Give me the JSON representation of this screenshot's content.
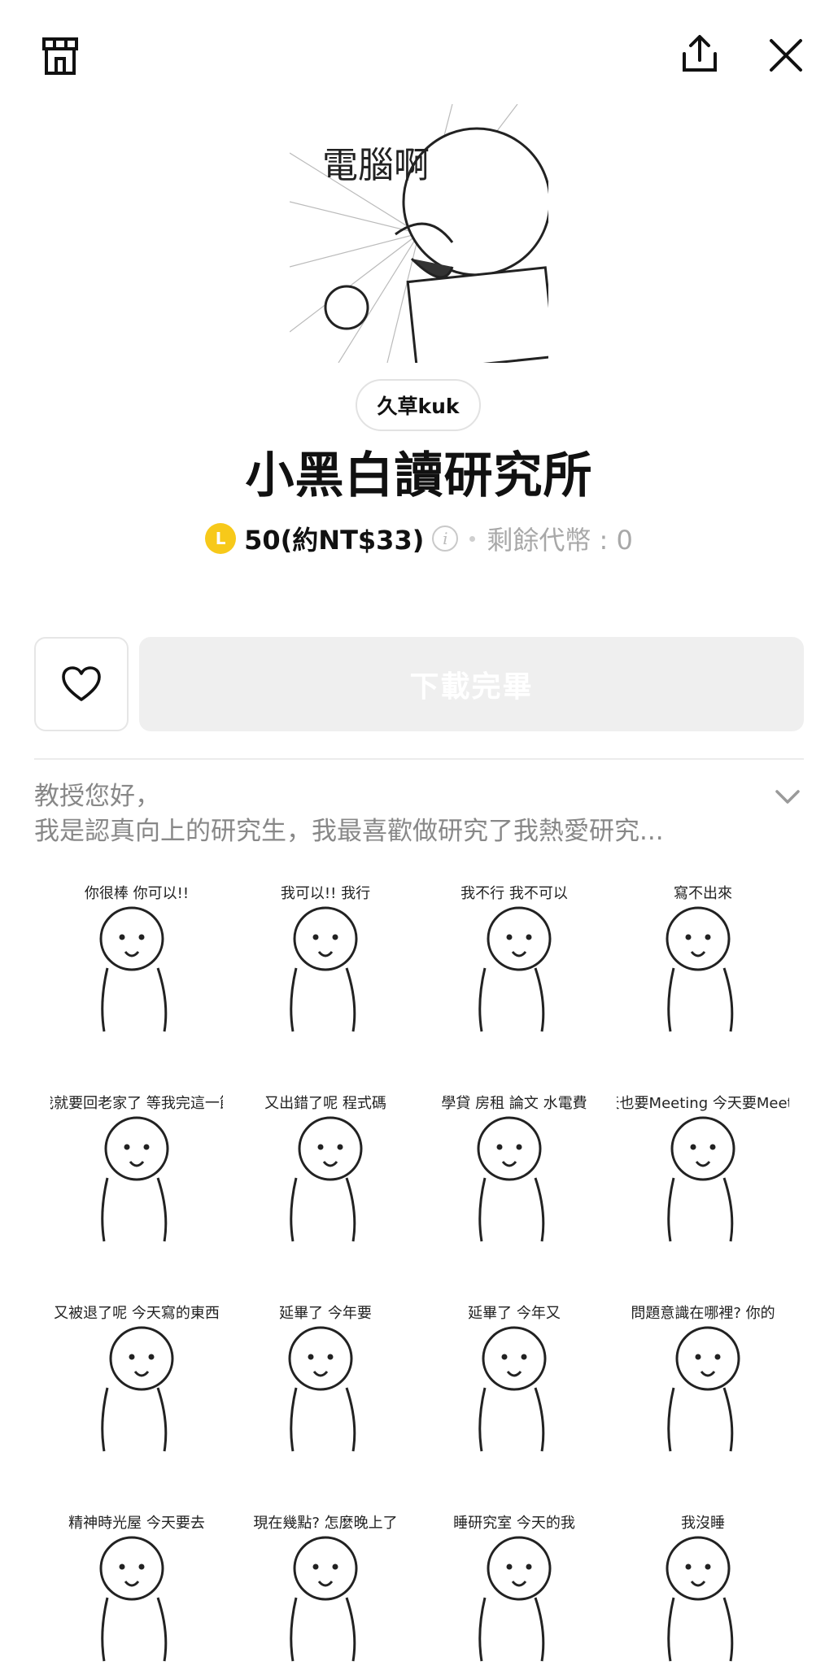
{
  "header": {
    "shop_icon": "shop-icon",
    "share_icon": "share-icon",
    "close_icon": "close-icon"
  },
  "product": {
    "main_image_text": "電腦啊",
    "author": "久草kuk",
    "title": "小黑白讀研究所",
    "price": "50(約NT$33)",
    "coin_symbol": "L",
    "tokens_left": "剩餘代幣 : 0"
  },
  "actions": {
    "favorite_icon": "heart-icon",
    "download_label": "下載完畢"
  },
  "description": {
    "line1": "教授您好，",
    "line2": "我是認真向上的研究生，我最喜歡做研究了我熱愛研究..."
  },
  "stickers": [
    {
      "text": "你很棒 你可以!!"
    },
    {
      "text": "我可以!! 我行"
    },
    {
      "text": "我不行 我不可以"
    },
    {
      "text": "寫不出來"
    },
    {
      "text": "我就要回老家了 等我完這一節"
    },
    {
      "text": "又出錯了呢 程式碼"
    },
    {
      "text": "學貸 房租 論文 水電費"
    },
    {
      "text": "明天也要Meeting 今天要Meeting"
    },
    {
      "text": "又被退了呢 今天寫的東西"
    },
    {
      "text": "延畢了 今年要"
    },
    {
      "text": "延畢了 今年又"
    },
    {
      "text": "問題意識在哪裡? 你的"
    },
    {
      "text": "精神時光屋 今天要去"
    },
    {
      "text": "現在幾點? 怎麼晚上了"
    },
    {
      "text": "睡研究室 今天的我"
    },
    {
      "text": "我沒睡"
    }
  ],
  "colors": {
    "coin": "#f7c91a",
    "download_bg": "#efefef",
    "muted_text": "#888888"
  }
}
